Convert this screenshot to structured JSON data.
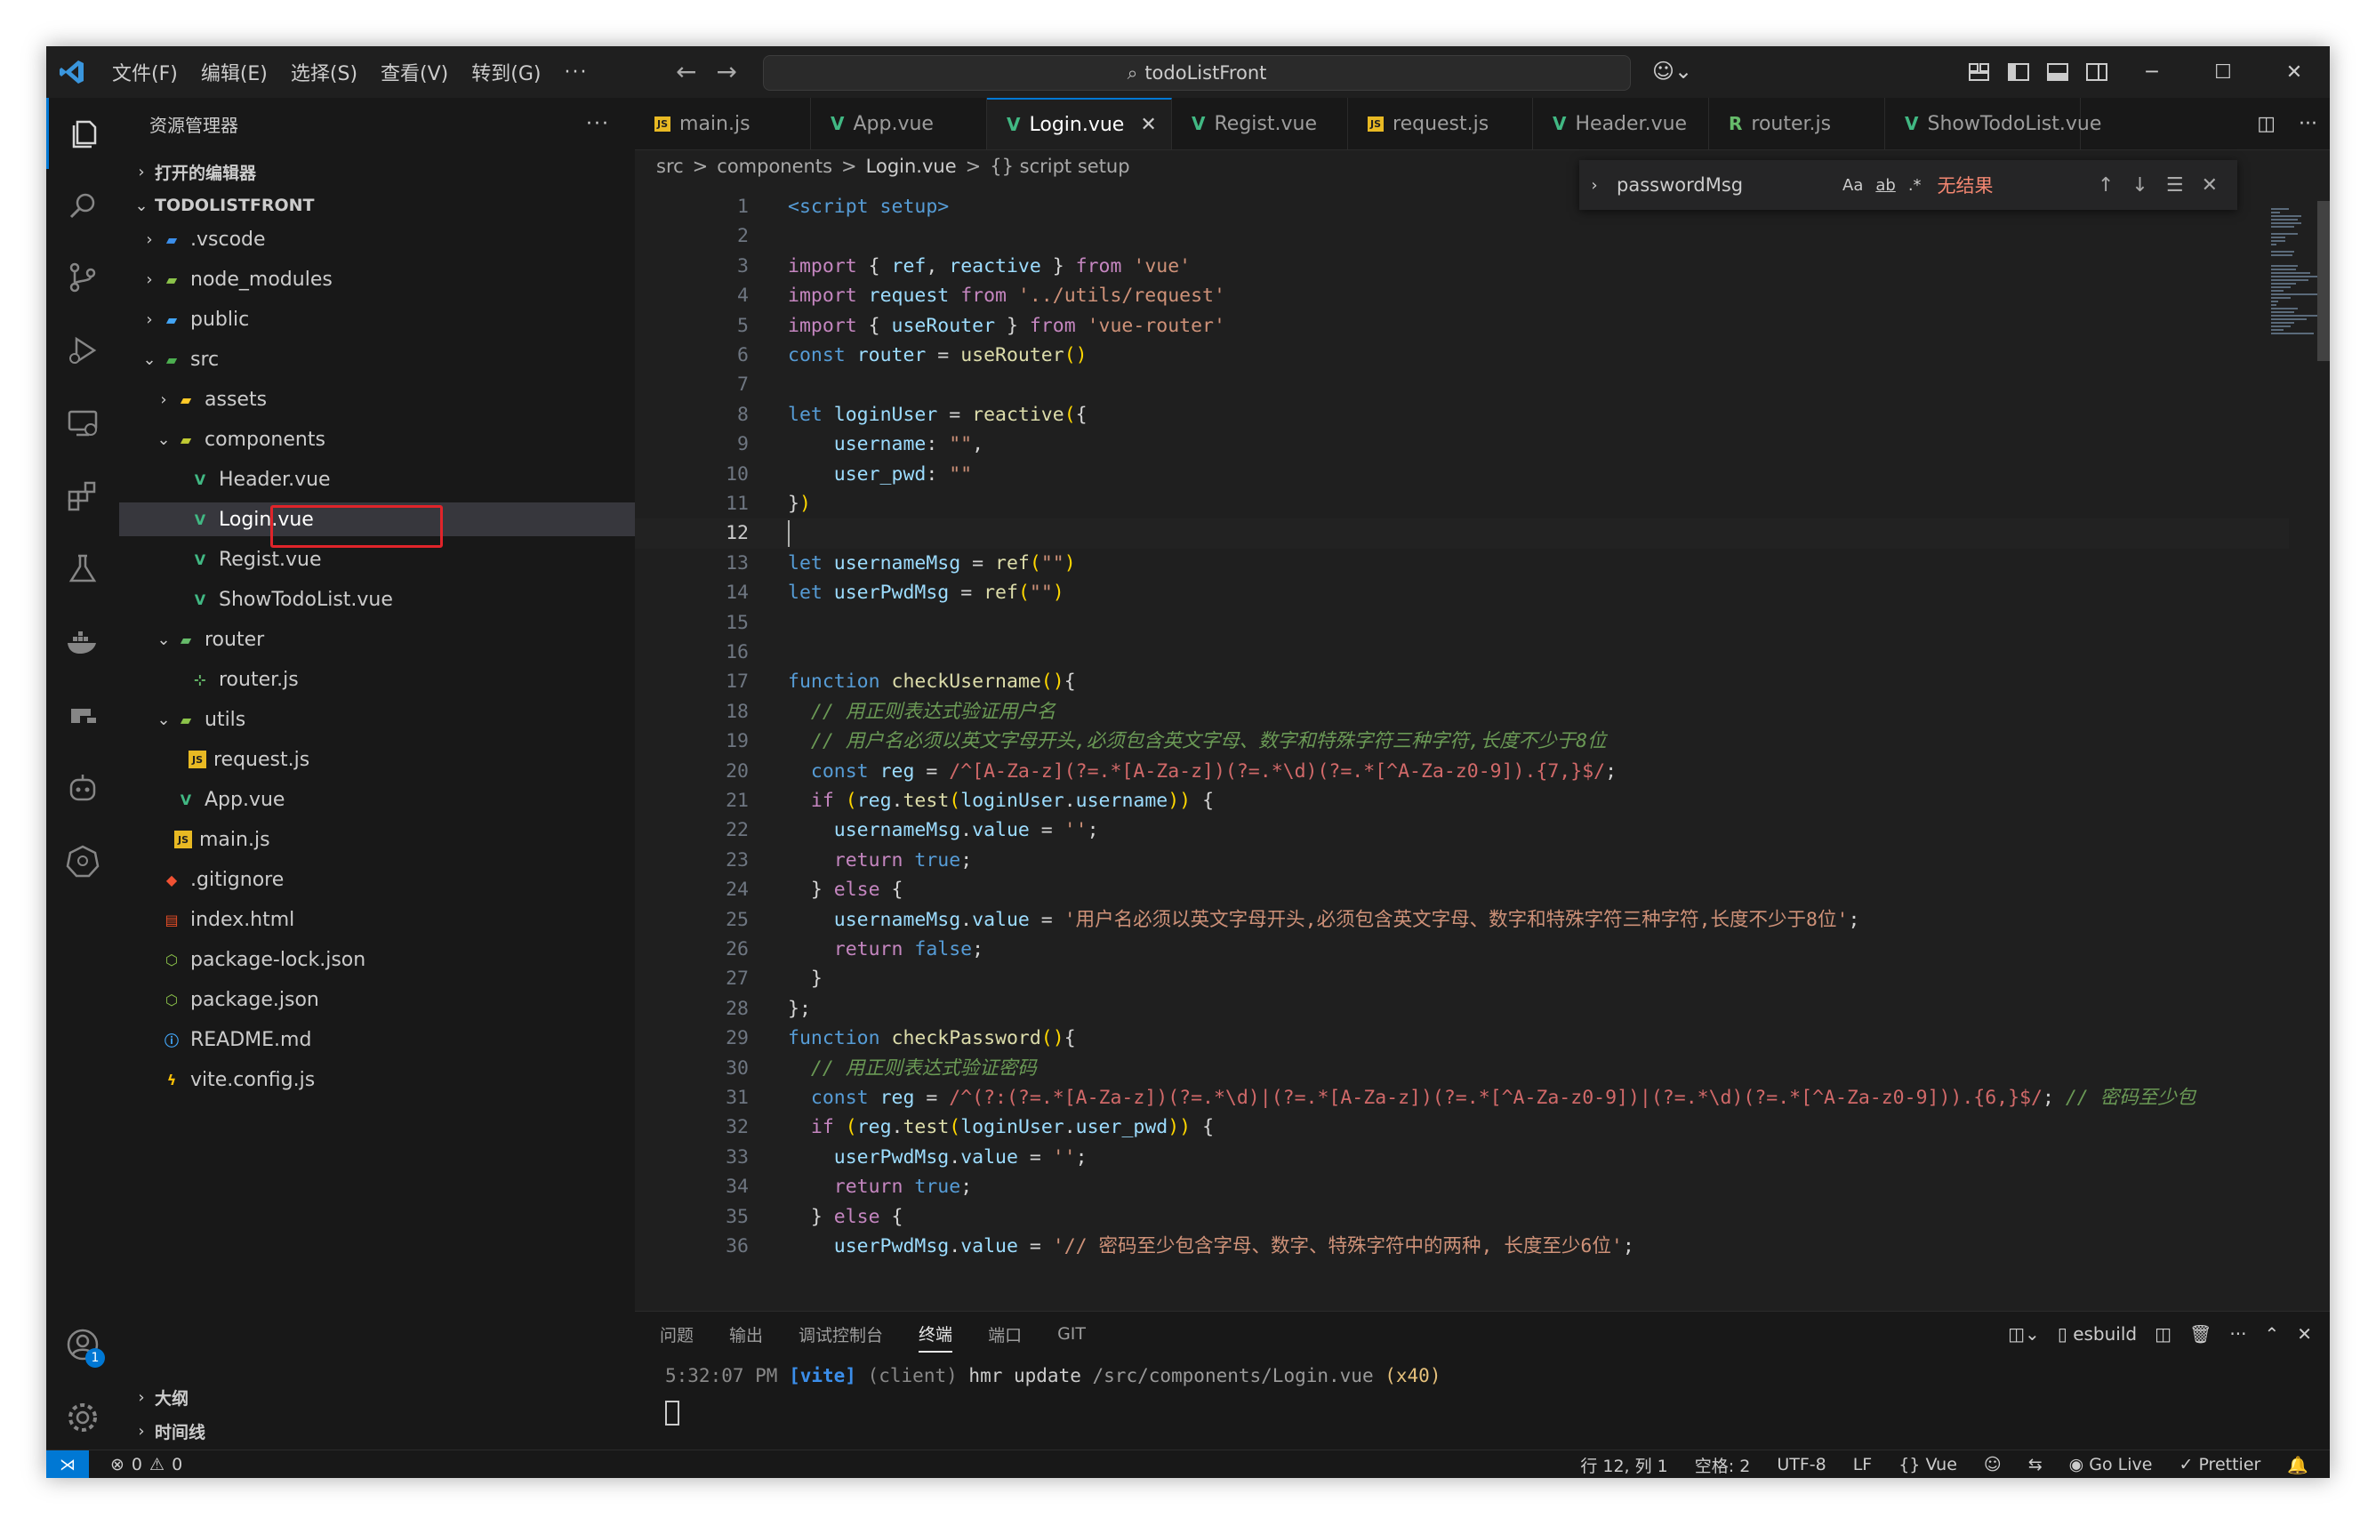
{
  "window": {
    "menu": [
      "文件(F)",
      "编辑(E)",
      "选择(S)",
      "查看(V)",
      "转到(G)"
    ],
    "menu_more": "···",
    "search_text": "todoListFront"
  },
  "sidebar": {
    "title": "资源管理器",
    "more": "···",
    "open_editors": "打开的编辑器",
    "project": "TODOLISTFRONT",
    "tree": [
      {
        "label": ".vscode",
        "chev": "›",
        "icon": "folder-vscode-icon"
      },
      {
        "label": "node_modules",
        "chev": "›",
        "icon": "folder-node-icon"
      },
      {
        "label": "public",
        "chev": "›",
        "icon": "folder-public-icon"
      },
      {
        "label": "src",
        "chev": "⌄",
        "icon": "folder-src-icon"
      },
      {
        "label": "assets",
        "chev": "›",
        "icon": "folder-assets-icon"
      },
      {
        "label": "components",
        "chev": "⌄",
        "icon": "folder-components-icon"
      },
      {
        "label": "Header.vue",
        "icon": "vue-file-icon"
      },
      {
        "label": "Login.vue",
        "icon": "vue-file-icon",
        "selected": true
      },
      {
        "label": "Regist.vue",
        "icon": "vue-file-icon"
      },
      {
        "label": "ShowTodoList.vue",
        "icon": "vue-file-icon"
      },
      {
        "label": "router",
        "chev": "⌄",
        "icon": "folder-router-icon"
      },
      {
        "label": "router.js",
        "icon": "router-file-icon"
      },
      {
        "label": "utils",
        "chev": "⌄",
        "icon": "folder-utils-icon"
      },
      {
        "label": "request.js",
        "icon": "js-file-icon"
      },
      {
        "label": "App.vue",
        "icon": "vue-file-icon"
      },
      {
        "label": "main.js",
        "icon": "js-file-icon"
      },
      {
        "label": ".gitignore",
        "icon": "git-file-icon"
      },
      {
        "label": "index.html",
        "icon": "html-file-icon"
      },
      {
        "label": "package-lock.json",
        "icon": "node-file-icon"
      },
      {
        "label": "package.json",
        "icon": "node-file-icon"
      },
      {
        "label": "README.md",
        "icon": "info-file-icon"
      },
      {
        "label": "vite.config.js",
        "icon": "vite-file-icon"
      }
    ],
    "outline": "大纲",
    "timeline": "时间线"
  },
  "tabs": [
    {
      "label": "main.js",
      "icon": "JS"
    },
    {
      "label": "App.vue",
      "icon": "V"
    },
    {
      "label": "Login.vue",
      "icon": "V",
      "active": true
    },
    {
      "label": "Regist.vue",
      "icon": "V"
    },
    {
      "label": "request.js",
      "icon": "JS"
    },
    {
      "label": "Header.vue",
      "icon": "V"
    },
    {
      "label": "router.js",
      "icon": "R"
    },
    {
      "label": "ShowTodoList.vue",
      "icon": "V"
    }
  ],
  "breadcrumb": [
    "src",
    ">",
    "components",
    ">",
    "Login.vue",
    ">",
    "{} script setup"
  ],
  "find": {
    "query": "passwordMsg",
    "opt_case": "Aa",
    "opt_word": "ab",
    "opt_regex": ".*",
    "result": "无结果"
  },
  "code": {
    "current_line": 12,
    "lines": [
      [
        [
          "tg",
          "<script setup>"
        ]
      ],
      [],
      [
        [
          "kc",
          "import"
        ],
        [
          "pn",
          " { "
        ],
        [
          "id",
          "ref"
        ],
        [
          "pn",
          ", "
        ],
        [
          "id",
          "reactive"
        ],
        [
          "pn",
          " } "
        ],
        [
          "kc",
          "from"
        ],
        [
          "pn",
          " "
        ],
        [
          "str",
          "'vue'"
        ]
      ],
      [
        [
          "kc",
          "import"
        ],
        [
          "pn",
          " "
        ],
        [
          "id",
          "request"
        ],
        [
          "pn",
          " "
        ],
        [
          "kc",
          "from"
        ],
        [
          "pn",
          " "
        ],
        [
          "str",
          "'../utils/request'"
        ]
      ],
      [
        [
          "kc",
          "import"
        ],
        [
          "pn",
          " { "
        ],
        [
          "id",
          "useRouter"
        ],
        [
          "pn",
          " } "
        ],
        [
          "kc",
          "from"
        ],
        [
          "pn",
          " "
        ],
        [
          "str",
          "'vue-router'"
        ]
      ],
      [
        [
          "kw",
          "const"
        ],
        [
          "pn",
          " "
        ],
        [
          "id",
          "router"
        ],
        [
          "pn",
          " = "
        ],
        [
          "fn",
          "useRouter"
        ],
        [
          "br",
          "()"
        ]
      ],
      [],
      [
        [
          "kw",
          "let"
        ],
        [
          "pn",
          " "
        ],
        [
          "id",
          "loginUser"
        ],
        [
          "pn",
          " = "
        ],
        [
          "fn",
          "reactive"
        ],
        [
          "br",
          "("
        ],
        [
          "pn",
          "{"
        ]
      ],
      [
        [
          "pn",
          "    "
        ],
        [
          "id",
          "username"
        ],
        [
          "pn",
          ": "
        ],
        [
          "str",
          "\"\""
        ],
        [
          "pn",
          ","
        ]
      ],
      [
        [
          "pn",
          "    "
        ],
        [
          "id",
          "user_pwd"
        ],
        [
          "pn",
          ": "
        ],
        [
          "str",
          "\"\""
        ]
      ],
      [
        [
          "pn",
          "}"
        ],
        [
          "br",
          ")"
        ]
      ],
      [],
      [
        [
          "kw",
          "let"
        ],
        [
          "pn",
          " "
        ],
        [
          "id",
          "usernameMsg"
        ],
        [
          "pn",
          " = "
        ],
        [
          "fn",
          "ref"
        ],
        [
          "br",
          "("
        ],
        [
          "str",
          "\"\""
        ],
        [
          "br",
          ")"
        ]
      ],
      [
        [
          "kw",
          "let"
        ],
        [
          "pn",
          " "
        ],
        [
          "id",
          "userPwdMsg"
        ],
        [
          "pn",
          " = "
        ],
        [
          "fn",
          "ref"
        ],
        [
          "br",
          "("
        ],
        [
          "str",
          "\"\""
        ],
        [
          "br",
          ")"
        ]
      ],
      [],
      [],
      [
        [
          "kw",
          "function"
        ],
        [
          "pn",
          " "
        ],
        [
          "fn",
          "checkUsername"
        ],
        [
          "br",
          "()"
        ],
        [
          "pn",
          "{"
        ]
      ],
      [
        [
          "pn",
          "  "
        ],
        [
          "cm",
          "// 用正则表达式验证用户名"
        ]
      ],
      [
        [
          "pn",
          "  "
        ],
        [
          "cm",
          "// 用户名必须以英文字母开头,必须包含英文字母、数字和特殊字符三种字符,长度不少于8位"
        ]
      ],
      [
        [
          "pn",
          "  "
        ],
        [
          "kw",
          "const"
        ],
        [
          "pn",
          " "
        ],
        [
          "id",
          "reg"
        ],
        [
          "pn",
          " = "
        ],
        [
          "re",
          "/^[A-Za-z](?=.*[A-Za-z])(?=.*\\d)(?=.*[^A-Za-z0-9]).{7,}$/"
        ],
        [
          "pn",
          ";"
        ]
      ],
      [
        [
          "pn",
          "  "
        ],
        [
          "kc",
          "if"
        ],
        [
          "pn",
          " "
        ],
        [
          "br",
          "("
        ],
        [
          "id",
          "reg"
        ],
        [
          "pn",
          "."
        ],
        [
          "fn",
          "test"
        ],
        [
          "br",
          "("
        ],
        [
          "id",
          "loginUser"
        ],
        [
          "pn",
          "."
        ],
        [
          "id",
          "username"
        ],
        [
          "br",
          "))"
        ],
        [
          "pn",
          " {"
        ]
      ],
      [
        [
          "pn",
          "    "
        ],
        [
          "id",
          "usernameMsg"
        ],
        [
          "pn",
          "."
        ],
        [
          "id",
          "value"
        ],
        [
          "pn",
          " = "
        ],
        [
          "str",
          "''"
        ],
        [
          "pn",
          ";"
        ]
      ],
      [
        [
          "pn",
          "    "
        ],
        [
          "kc",
          "return"
        ],
        [
          "pn",
          " "
        ],
        [
          "kw",
          "true"
        ],
        [
          "pn",
          ";"
        ]
      ],
      [
        [
          "pn",
          "  } "
        ],
        [
          "kc",
          "else"
        ],
        [
          "pn",
          " {"
        ]
      ],
      [
        [
          "pn",
          "    "
        ],
        [
          "id",
          "usernameMsg"
        ],
        [
          "pn",
          "."
        ],
        [
          "id",
          "value"
        ],
        [
          "pn",
          " = "
        ],
        [
          "str",
          "'用户名必须以英文字母开头,必须包含英文字母、数字和特殊字符三种字符,长度不少于8位'"
        ],
        [
          "pn",
          ";"
        ]
      ],
      [
        [
          "pn",
          "    "
        ],
        [
          "kc",
          "return"
        ],
        [
          "pn",
          " "
        ],
        [
          "kw",
          "false"
        ],
        [
          "pn",
          ";"
        ]
      ],
      [
        [
          "pn",
          "  }"
        ]
      ],
      [
        [
          "pn",
          "};"
        ]
      ],
      [
        [
          "kw",
          "function"
        ],
        [
          "pn",
          " "
        ],
        [
          "fn",
          "checkPassword"
        ],
        [
          "br",
          "()"
        ],
        [
          "pn",
          "{"
        ]
      ],
      [
        [
          "pn",
          "  "
        ],
        [
          "cm",
          "// 用正则表达式验证密码"
        ]
      ],
      [
        [
          "pn",
          "  "
        ],
        [
          "kw",
          "const"
        ],
        [
          "pn",
          " "
        ],
        [
          "id",
          "reg"
        ],
        [
          "pn",
          " = "
        ],
        [
          "re",
          "/^(?:(?=.*[A-Za-z])(?=.*\\d)|(?=.*[A-Za-z])(?=.*[^A-Za-z0-9])|(?=.*\\d)(?=.*[^A-Za-z0-9])).{6,}$/"
        ],
        [
          "pn",
          "; "
        ],
        [
          "cm",
          "// 密码至少包"
        ]
      ],
      [
        [
          "pn",
          "  "
        ],
        [
          "kc",
          "if"
        ],
        [
          "pn",
          " "
        ],
        [
          "br",
          "("
        ],
        [
          "id",
          "reg"
        ],
        [
          "pn",
          "."
        ],
        [
          "fn",
          "test"
        ],
        [
          "br",
          "("
        ],
        [
          "id",
          "loginUser"
        ],
        [
          "pn",
          "."
        ],
        [
          "id",
          "user_pwd"
        ],
        [
          "br",
          "))"
        ],
        [
          "pn",
          " {"
        ]
      ],
      [
        [
          "pn",
          "    "
        ],
        [
          "id",
          "userPwdMsg"
        ],
        [
          "pn",
          "."
        ],
        [
          "id",
          "value"
        ],
        [
          "pn",
          " = "
        ],
        [
          "str",
          "''"
        ],
        [
          "pn",
          ";"
        ]
      ],
      [
        [
          "pn",
          "    "
        ],
        [
          "kc",
          "return"
        ],
        [
          "pn",
          " "
        ],
        [
          "kw",
          "true"
        ],
        [
          "pn",
          ";"
        ]
      ],
      [
        [
          "pn",
          "  } "
        ],
        [
          "kc",
          "else"
        ],
        [
          "pn",
          " {"
        ]
      ],
      [
        [
          "pn",
          "    "
        ],
        [
          "id",
          "userPwdMsg"
        ],
        [
          "pn",
          "."
        ],
        [
          "id",
          "value"
        ],
        [
          "pn",
          " = "
        ],
        [
          "str",
          "'// 密码至少包含字母、数字、特殊字符中的两种, 长度至少6位'"
        ],
        [
          "pn",
          ";"
        ]
      ]
    ]
  },
  "panel": {
    "tabs": [
      "问题",
      "输出",
      "调试控制台",
      "终端",
      "端口",
      "GIT"
    ],
    "active_tab": "终端",
    "terminal_name": "esbuild",
    "term_time": "5:32:07 PM",
    "term_tag": "[vite]",
    "term_client": "(client)",
    "term_msg": "hmr update",
    "term_path": "/src/components/Login.vue",
    "term_count": "(x40)"
  },
  "status": {
    "errors": "0",
    "warnings": "0",
    "position": "行 12, 列 1",
    "spaces": "空格: 2",
    "encoding": "UTF-8",
    "eol": "LF",
    "language": "Vue",
    "golive": "Go Live",
    "prettier": "Prettier"
  },
  "account_badge": "1",
  "colors": {
    "accent": "#0078d4",
    "highlight_box": "#e0242a",
    "find_no_result": "#f48771"
  }
}
